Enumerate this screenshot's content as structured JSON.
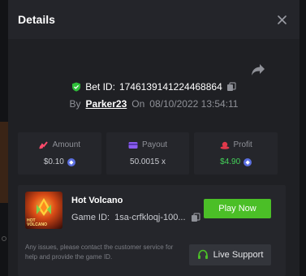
{
  "modal": {
    "title": "Details"
  },
  "bet": {
    "id_label": "Bet ID:",
    "id_value": "1746139141224468864",
    "by_label": "By",
    "username": "Parker23",
    "on_label": "On",
    "timestamp": "08/10/2022 13:54:11"
  },
  "stats": [
    {
      "label": "Amount",
      "value": "$0.10",
      "icon": "amount-icon",
      "coin": true
    },
    {
      "label": "Payout",
      "value": "50.0015 x",
      "icon": "payout-icon",
      "coin": false
    },
    {
      "label": "Profit",
      "value": "$4.90",
      "icon": "profit-icon",
      "coin": true
    }
  ],
  "game": {
    "title": "Hot Volcano",
    "id_label": "Game ID:",
    "id_value": "1sa-crfkloqj-100...",
    "thumb_text_1": "HOT",
    "thumb_text_2": "VOLCANO",
    "play_label": "Play Now",
    "help_text": "Any issues, please contact the customer service for help and provide the game ID.",
    "support_label": "Live Support"
  },
  "colors": {
    "accent_green": "#4bbf27",
    "profit_green": "#44d35a",
    "coin_blue": "#5b6fe0"
  }
}
